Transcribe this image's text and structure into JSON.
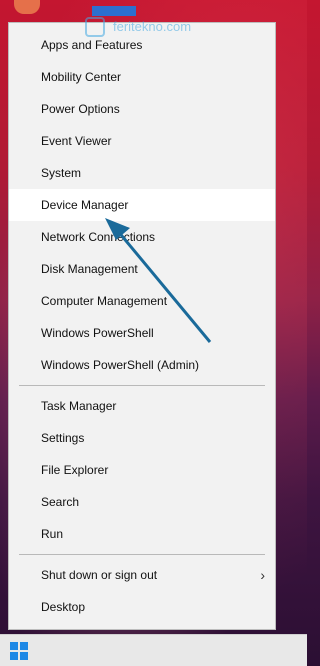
{
  "watermark": {
    "text": "feritekno.com"
  },
  "menu": {
    "group1": [
      {
        "label": "Apps and Features"
      },
      {
        "label": "Mobility Center"
      },
      {
        "label": "Power Options"
      },
      {
        "label": "Event Viewer"
      },
      {
        "label": "System"
      },
      {
        "label": "Device Manager"
      },
      {
        "label": "Network Connections"
      },
      {
        "label": "Disk Management"
      },
      {
        "label": "Computer Management"
      },
      {
        "label": "Windows PowerShell"
      },
      {
        "label": "Windows PowerShell (Admin)"
      }
    ],
    "group2": [
      {
        "label": "Task Manager"
      },
      {
        "label": "Settings"
      },
      {
        "label": "File Explorer"
      },
      {
        "label": "Search"
      },
      {
        "label": "Run"
      }
    ],
    "group3": [
      {
        "label": "Shut down or sign out"
      },
      {
        "label": "Desktop"
      }
    ],
    "selected": "Device Manager"
  },
  "colors": {
    "annotation_arrow": "#1a6a9a",
    "start_icon": "#1e88e5",
    "menu_bg": "#f2f2f2"
  },
  "icons": {
    "submenu": "chevron-right-icon",
    "start": "windows-logo-icon"
  }
}
